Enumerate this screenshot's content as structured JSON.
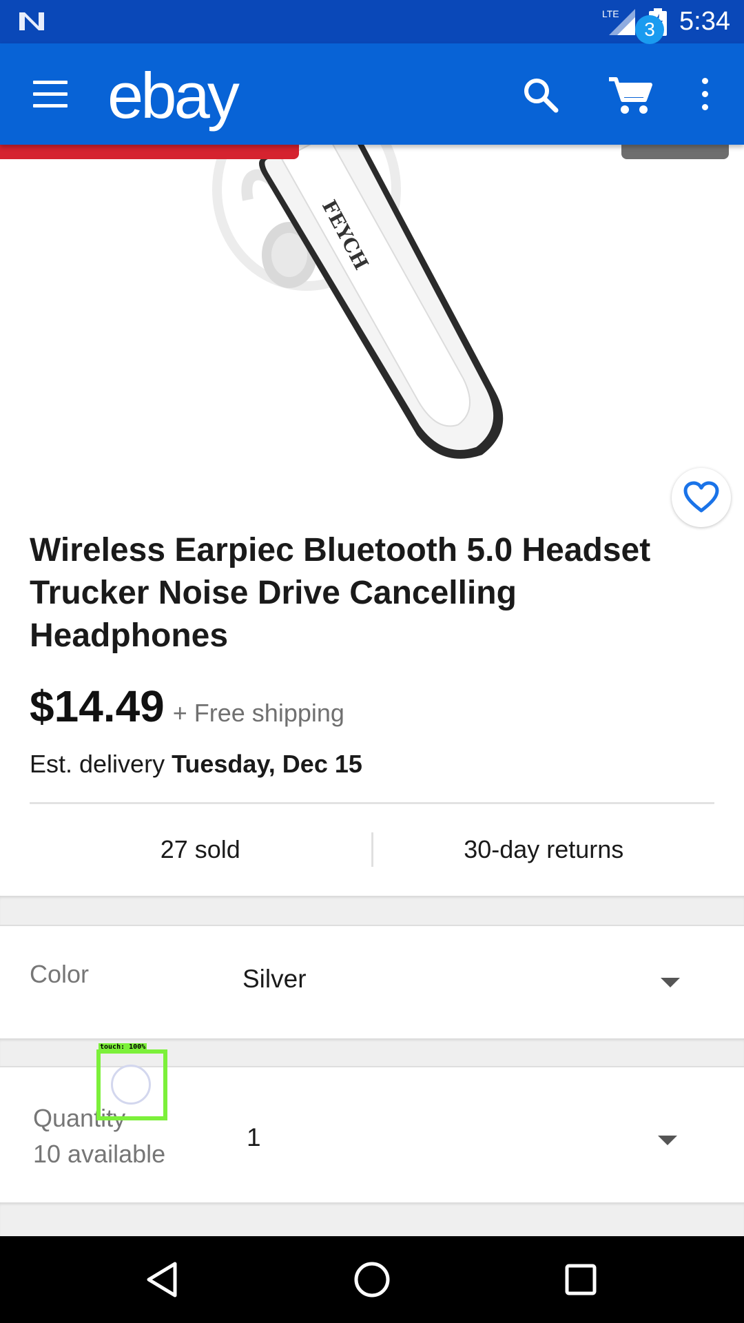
{
  "status_bar": {
    "time": "5:34",
    "network": "LTE",
    "icons": [
      "n-notification-icon",
      "lte-signal-icon",
      "battery-charging-icon"
    ]
  },
  "app_bar": {
    "logo": "ebay",
    "cart_count": "3",
    "icons": [
      "menu-icon",
      "search-icon",
      "cart-icon",
      "more-vert-icon"
    ],
    "colors": {
      "status_bar": "#0a48b8",
      "app_bar": "#0863d6",
      "badge": "#1a9bf0"
    }
  },
  "product": {
    "image_alt": "white Bluetooth earpiece",
    "brand_on_image": "FEYCH",
    "title": "Wireless Earpiec Bluetooth 5.0 Headset Trucker Noise Drive Cancelling Headphones",
    "price": "$14.49",
    "shipping": "+ Free shipping",
    "delivery_prefix": "Est. delivery ",
    "delivery_date": "Tuesday, Dec 15",
    "sold": "27 sold",
    "returns": "30-day returns"
  },
  "options": {
    "color": {
      "label": "Color",
      "value": "Silver"
    },
    "quantity": {
      "label": "Quantity",
      "available": "10 available",
      "value": "1"
    }
  },
  "touch_overlay": {
    "label": "touch: 100%"
  },
  "nav_bar": {
    "icons": [
      "back-icon",
      "home-icon",
      "recents-icon"
    ]
  }
}
